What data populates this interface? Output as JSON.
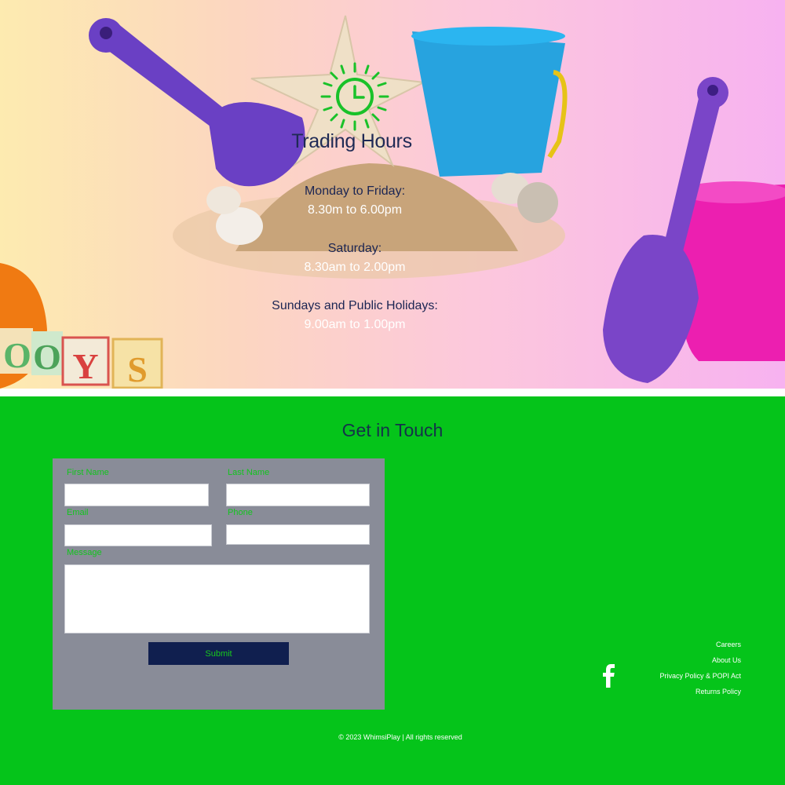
{
  "trading": {
    "title": "Trading Hours",
    "blocks": [
      {
        "day": "Monday to Friday:",
        "time": "8.30m to 6.00pm"
      },
      {
        "day": "Saturday:",
        "time": "8.30am to 2.00pm"
      },
      {
        "day": "Sundays and Public Holidays:",
        "time": "9.00am to 1.00pm"
      }
    ],
    "blocks_letters": "OOYS"
  },
  "contact": {
    "title": "Get in Touch",
    "form": {
      "first_name_label": "First Name",
      "last_name_label": "Last Name",
      "email_label": "Email",
      "phone_label": "Phone",
      "message_label": "Message",
      "submit_label": "Submit"
    }
  },
  "footer": {
    "links": [
      "Careers",
      "About Us",
      "Privacy Policy & POPI Act",
      "Returns Policy"
    ],
    "copyright": "© 2023 WhimsiPlay | All rights reserved",
    "social_icon": "facebook-icon"
  },
  "colors": {
    "contact_bg": "#05c41a",
    "form_bg": "#898c98",
    "button_bg": "#101f4f",
    "clock_green": "#19c229"
  }
}
